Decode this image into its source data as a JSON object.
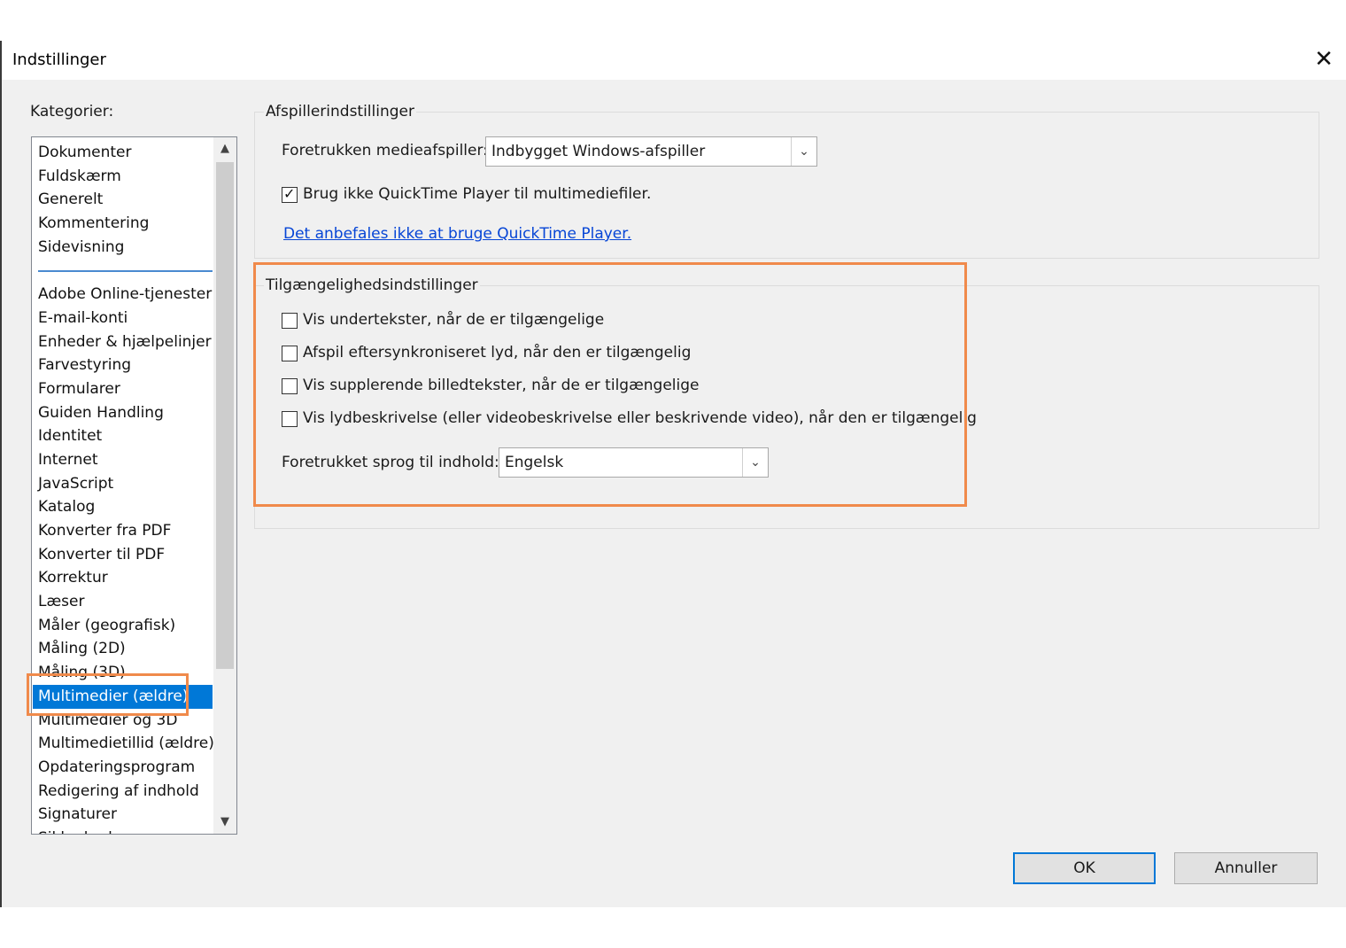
{
  "window": {
    "title": "Indstillinger",
    "close_glyph": "✕"
  },
  "categories": {
    "label": "Kategorier:",
    "top_items": [
      "Dokumenter",
      "Fuldskærm",
      "Generelt",
      "Kommentering",
      "Sidevisning"
    ],
    "items": [
      "Adobe Online-tjenester",
      "E-mail-konti",
      "Enheder & hjælpelinjer",
      "Farvestyring",
      "Formularer",
      "Guiden Handling",
      "Identitet",
      "Internet",
      "JavaScript",
      "Katalog",
      "Konverter fra PDF",
      "Konverter til PDF",
      "Korrektur",
      "Læser",
      "Måler (geografisk)",
      "Måling (2D)",
      "Måling (3D)",
      "Multimedier (ældre)",
      "Multimedier og 3D",
      "Multimedietillid (ældre)",
      "Opdateringsprogram",
      "Redigering af indhold",
      "Signaturer",
      "Sikkerhed"
    ],
    "selected": "Multimedier (ældre)",
    "scroll_up_glyph": "▲",
    "scroll_down_glyph": "▼"
  },
  "player": {
    "legend": "Afspillerindstillinger",
    "preferred_label": "Foretrukken medieafspiller:",
    "preferred_value": "Indbygget Windows-afspiller",
    "quicktime_checkbox_label": "Brug ikke QuickTime Player til multimediefiler.",
    "quicktime_checked": true,
    "link_text": "Det anbefales ikke at bruge QuickTime Player."
  },
  "accessibility": {
    "legend": "Tilgængelighedsindstillinger",
    "options": [
      {
        "label": "Vis undertekster, når de er tilgængelige",
        "checked": false
      },
      {
        "label": "Afspil eftersynkroniseret lyd, når den er tilgængelig",
        "checked": false
      },
      {
        "label": "Vis supplerende billedtekster, når de er tilgængelige",
        "checked": false
      },
      {
        "label": "Vis lydbeskrivelse (eller videobeskrivelse eller beskrivende video), når den er tilgængelig",
        "checked": false
      }
    ],
    "language_label": "Foretrukket sprog til indhold:",
    "language_value": "Engelsk"
  },
  "icons": {
    "dropdown": "chevron-down-icon",
    "check": "checkmark-icon"
  },
  "check_glyph": "✓",
  "dropdown_glyph": "⌄",
  "buttons": {
    "ok": "OK",
    "cancel": "Annuller"
  },
  "colors": {
    "selection": "#0078d7",
    "highlight": "#f08a4b",
    "link": "#0645d6"
  }
}
